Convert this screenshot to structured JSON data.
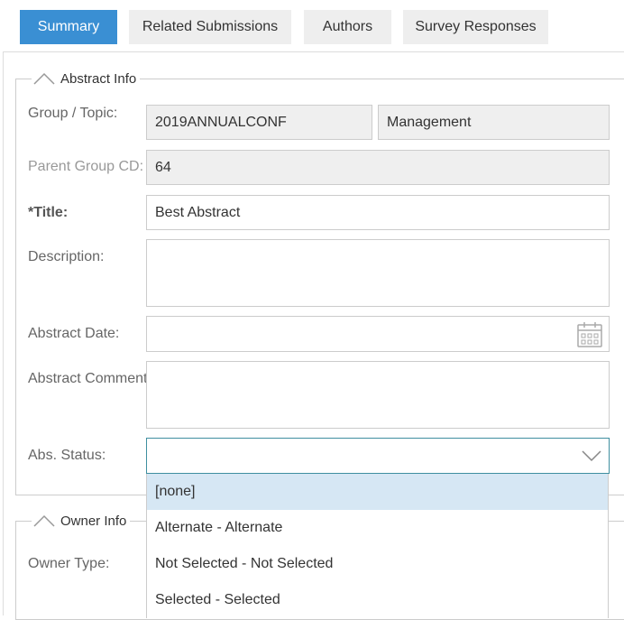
{
  "tabs": [
    {
      "label": "Summary",
      "active": true
    },
    {
      "label": "Related Submissions",
      "active": false
    },
    {
      "label": "Authors",
      "active": false
    },
    {
      "label": "Survey Responses",
      "active": false
    }
  ],
  "abstract_info": {
    "legend": "Abstract Info",
    "group_topic": {
      "label": "Group / Topic:",
      "group_value": "2019ANNUALCONF",
      "topic_value": "Management"
    },
    "parent_group": {
      "label": "Parent Group CD:",
      "value": "64"
    },
    "title": {
      "label": "*Title:",
      "value": "Best Abstract"
    },
    "description": {
      "label": "Description:",
      "value": ""
    },
    "abstract_date": {
      "label": "Abstract Date:",
      "value": "",
      "icon": "calendar-icon"
    },
    "abstract_comment": {
      "label": "Abstract Comment:",
      "value": ""
    },
    "abs_status": {
      "label": "Abs. Status:",
      "value": "",
      "icon": "chevron-down-icon",
      "options": [
        {
          "label": "[none]",
          "highlighted": true
        },
        {
          "label": "Alternate - Alternate",
          "highlighted": false
        },
        {
          "label": "Not Selected - Not Selected",
          "highlighted": false
        },
        {
          "label": "Selected - Selected",
          "highlighted": false
        }
      ]
    }
  },
  "owner_info": {
    "legend": "Owner Info",
    "owner_type": {
      "label": "Owner Type:"
    }
  },
  "colors": {
    "accent": "#3a8fd3",
    "tab_inactive": "#eeeeee",
    "readonly_bg": "#efefef",
    "option_highlight": "#d6e7f4",
    "select_border": "#3f8fa0"
  }
}
